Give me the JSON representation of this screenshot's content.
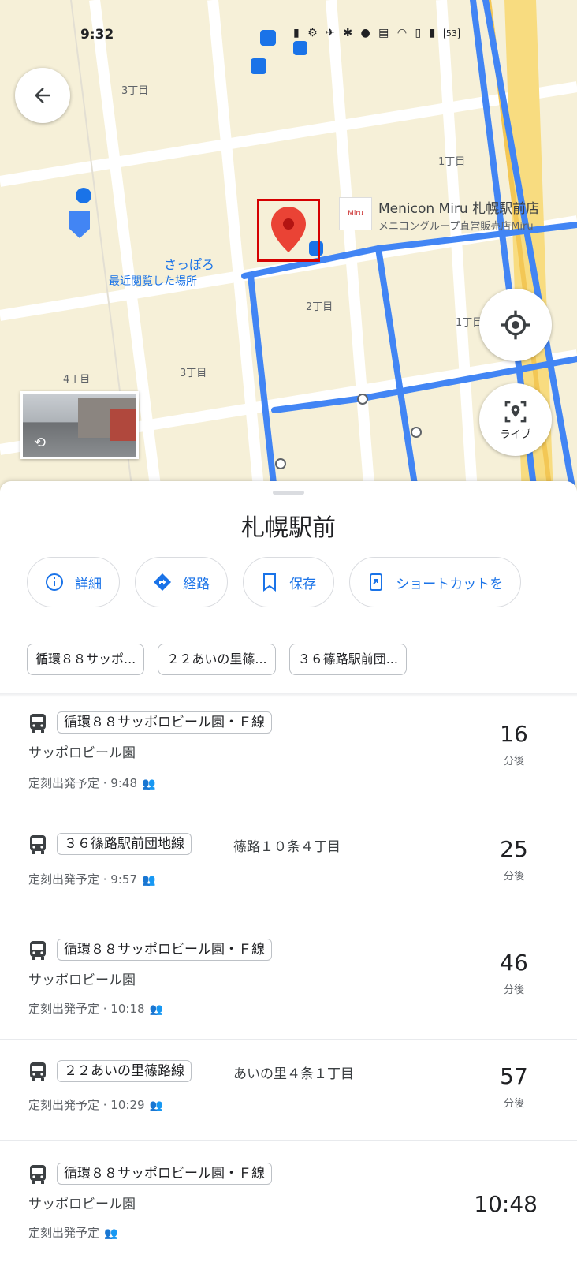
{
  "status": {
    "time": "9:32",
    "battery": "53"
  },
  "map": {
    "labels": {
      "block_3chome_top": "3丁目",
      "block_1chome_right": "1丁目",
      "block_2chome": "2丁目",
      "block_1chome_mid": "1丁目",
      "block_3chome_bottom": "3丁目",
      "block_4chome": "4丁目",
      "sapporo": "さっぽろ",
      "recent": "最近閲覧した場所"
    },
    "poi": {
      "name": "Menicon Miru 札幌駅前店",
      "subtitle": "メニコングループ直営販売店Miru",
      "logo_text": "Miru"
    },
    "live_label": "ライブ"
  },
  "sheet": {
    "title": "札幌駅前",
    "actions": [
      {
        "label": "詳細",
        "icon": "info-icon"
      },
      {
        "label": "経路",
        "icon": "directions-icon"
      },
      {
        "label": "保存",
        "icon": "bookmark-icon"
      },
      {
        "label": "ショートカットを",
        "icon": "shortcut-icon"
      }
    ],
    "route_filters": [
      "循環８８サッポ...",
      "２２あいの里篠...",
      "３６篠路駅前団..."
    ]
  },
  "departures": [
    {
      "line": "循環８８サッポロビール園・Ｆ線",
      "destination": "サッポロビール園",
      "inline_dest": "",
      "schedule": "定刻出発予定 · 9:48",
      "minutes": "16",
      "unit": "分後",
      "clock": ""
    },
    {
      "line": "３６篠路駅前団地線",
      "destination": "",
      "inline_dest": "篠路１０条４丁目",
      "schedule": "定刻出発予定 · 9:57",
      "minutes": "25",
      "unit": "分後",
      "clock": ""
    },
    {
      "line": "循環８８サッポロビール園・Ｆ線",
      "destination": "サッポロビール園",
      "inline_dest": "",
      "schedule": "定刻出発予定 · 10:18",
      "minutes": "46",
      "unit": "分後",
      "clock": ""
    },
    {
      "line": "２２あいの里篠路線",
      "destination": "",
      "inline_dest": "あいの里４条１丁目",
      "schedule": "定刻出発予定 · 10:29",
      "minutes": "57",
      "unit": "分後",
      "clock": ""
    },
    {
      "line": "循環８８サッポロビール園・Ｆ線",
      "destination": "サッポロビール園",
      "inline_dest": "",
      "schedule": "定刻出発予定",
      "minutes": "",
      "unit": "",
      "clock": "10:48"
    }
  ]
}
